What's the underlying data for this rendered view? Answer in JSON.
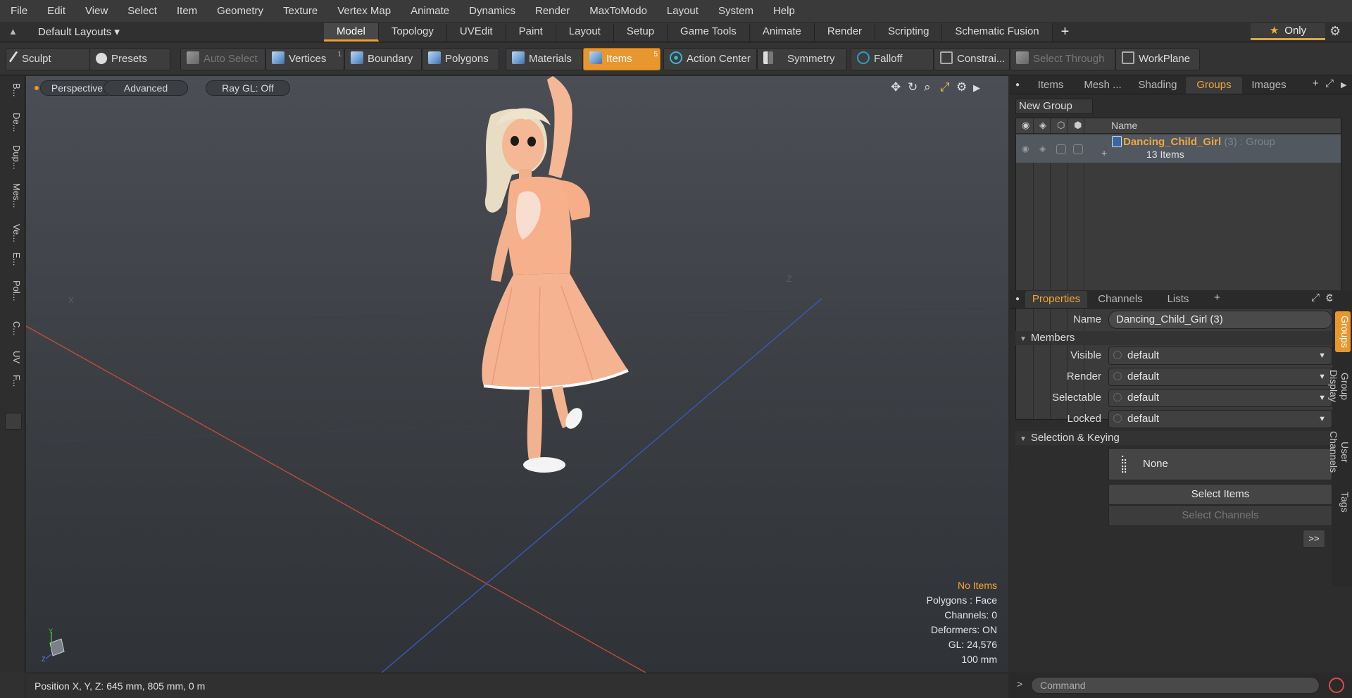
{
  "menubar": {
    "items": [
      "File",
      "Edit",
      "View",
      "Select",
      "Item",
      "Geometry",
      "Texture",
      "Vertex Map",
      "Animate",
      "Dynamics",
      "Render",
      "MaxToModo",
      "Layout",
      "System",
      "Help"
    ]
  },
  "layoutbar": {
    "layouts_label": "Default Layouts ▾",
    "tabs": [
      "Model",
      "Topology",
      "UVEdit",
      "Paint",
      "Layout",
      "Setup",
      "Game Tools",
      "Animate",
      "Render",
      "Scripting",
      "Schematic Fusion"
    ],
    "active_tab": "Model",
    "plus": "+",
    "only_label": "Only"
  },
  "toolbar": {
    "sculpt": "Sculpt",
    "presets": "Presets",
    "auto_select": "Auto Select",
    "vertices": "Vertices",
    "vertices_count": "1",
    "boundary": "Boundary",
    "polygons": "Polygons",
    "materials": "Materials",
    "items": "Items",
    "items_count": "5",
    "action_center": "Action Center",
    "symmetry": "Symmetry",
    "falloff": "Falloff",
    "constraints": "Constrai...",
    "select_through": "Select Through",
    "workplane": "WorkPlane"
  },
  "leftstrip": {
    "tabs": [
      "B...",
      "De...",
      "Dup...",
      "Mes...",
      "Ve...",
      "E...",
      "Pol...",
      "C...",
      "UV",
      "F..."
    ]
  },
  "viewport": {
    "perspective": "Perspective",
    "advanced": "Advanced",
    "raygl": "Ray GL: Off",
    "info": {
      "items": "No Items",
      "polygons": "Polygons : Face",
      "channels": "Channels: 0",
      "deformers": "Deformers: ON",
      "gl": "GL: 24,576",
      "scale": "100 mm"
    },
    "axis_x": "X",
    "axis_y": "Y",
    "axis_z": "Z"
  },
  "statusbar": {
    "position": "Position X, Y, Z:   645 mm, 805 mm, 0 m"
  },
  "right_top_tabs": [
    "Items",
    "Mesh ...",
    "Shading",
    "Groups",
    "Images"
  ],
  "right_top_active": "Groups",
  "groups": {
    "new_group": "New Group",
    "col_name": "Name",
    "group_name": "Dancing_Child_Girl",
    "group_suffix": " (3) : Group",
    "group_count": "13 Items"
  },
  "props_tabs": [
    "Properties",
    "Channels",
    "Lists"
  ],
  "props_active": "Properties",
  "properties": {
    "name_label": "Name",
    "name_value": "Dancing_Child_Girl (3)",
    "members_section": "Members",
    "visible_label": "Visible",
    "visible_value": "default",
    "render_label": "Render",
    "render_value": "default",
    "selectable_label": "Selectable",
    "selectable_value": "default",
    "locked_label": "Locked",
    "locked_value": "default",
    "keying_section": "Selection & Keying",
    "none_label": "None",
    "select_items": "Select Items",
    "select_channels": "Select Channels",
    "more": ">>"
  },
  "side_tabs": [
    "Groups",
    "Group Display",
    "User Channels",
    "Tags"
  ],
  "side_active": "Groups",
  "command": {
    "placeholder": "Command",
    "chevron": ">"
  },
  "colors": {
    "accent": "#e8972f",
    "highlight_text": "#f2a73b",
    "dress": "#f4b592"
  }
}
